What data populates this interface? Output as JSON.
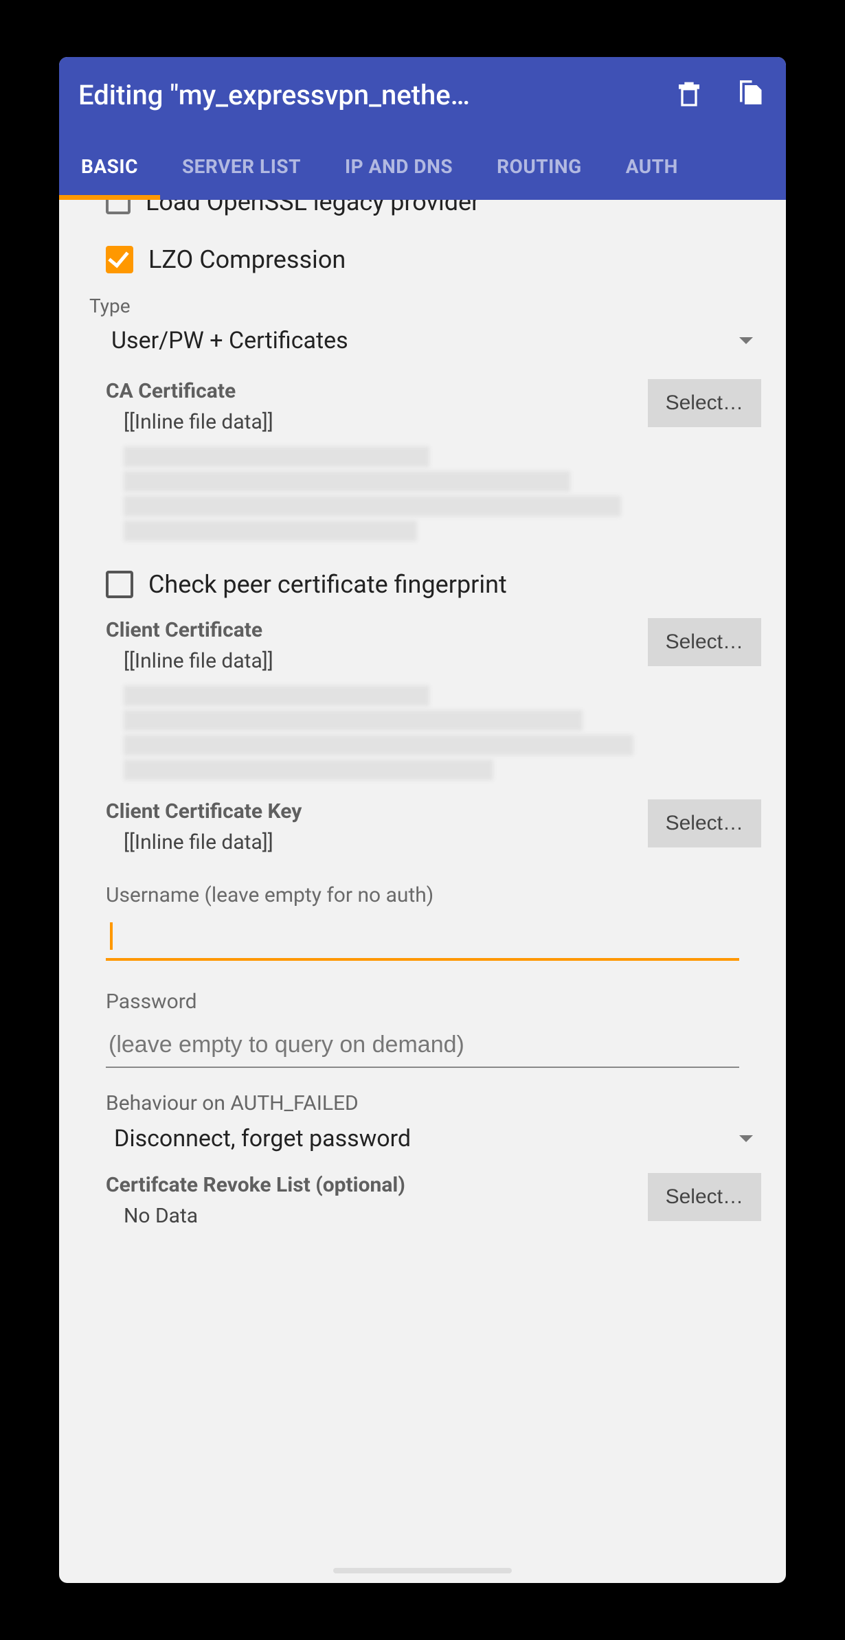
{
  "appbar": {
    "title": "Editing \"my_expressvpn_nethe…"
  },
  "tabs": [
    {
      "label": "BASIC",
      "active": true
    },
    {
      "label": "SERVER LIST",
      "active": false
    },
    {
      "label": "IP AND DNS",
      "active": false
    },
    {
      "label": "ROUTING",
      "active": false
    },
    {
      "label": "AUTH",
      "active": false
    }
  ],
  "options": {
    "lzo_label": "LZO Compression",
    "lzo_checked": true
  },
  "type": {
    "label": "Type",
    "value": "User/PW + Certificates"
  },
  "ca_cert": {
    "title": "CA Certificate",
    "value": "[[Inline file data]]",
    "select": "Select…"
  },
  "peer_fp": {
    "label": "Check peer certificate fingerprint",
    "checked": false
  },
  "client_cert": {
    "title": "Client Certificate",
    "value": "[[Inline file data]]",
    "select": "Select…"
  },
  "client_key": {
    "title": "Client Certificate Key",
    "value": "[[Inline file data]]",
    "select": "Select…"
  },
  "username": {
    "label": "Username (leave empty for no auth)",
    "value": ""
  },
  "password": {
    "label": "Password",
    "placeholder": "(leave empty to query on demand)",
    "value": ""
  },
  "auth_failed": {
    "label": "Behaviour on AUTH_FAILED",
    "value": "Disconnect, forget password"
  },
  "crl": {
    "title": "Certifcate Revoke List (optional)",
    "value": "No Data",
    "select": "Select…"
  }
}
